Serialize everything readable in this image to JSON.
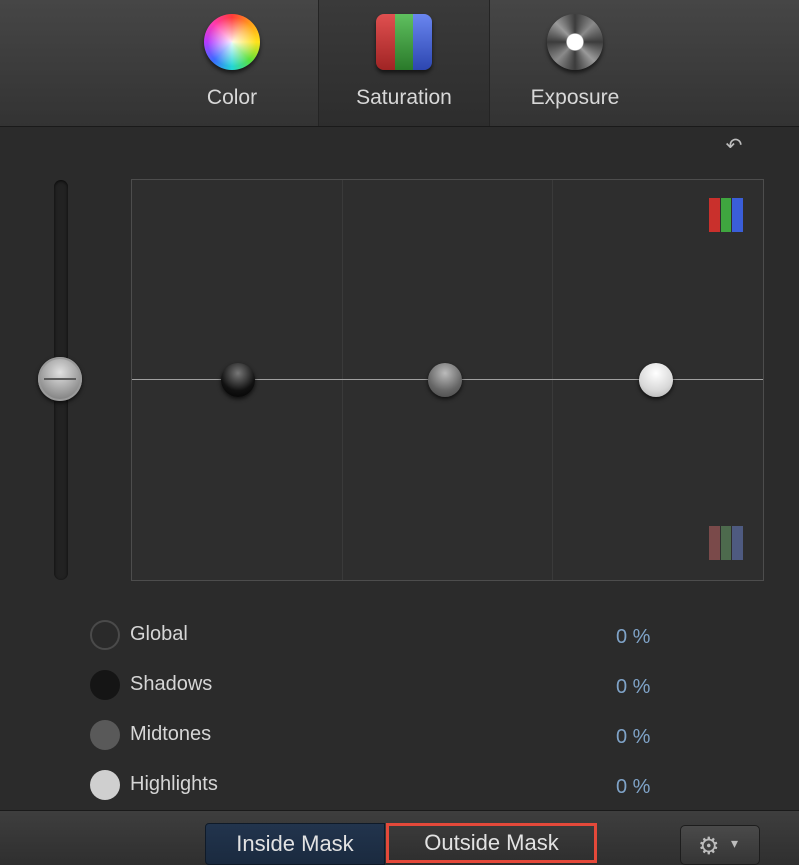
{
  "tabs": [
    {
      "label": "Color",
      "icon": "color-wheel-icon"
    },
    {
      "label": "Saturation",
      "icon": "saturation-bars-icon"
    },
    {
      "label": "Exposure",
      "icon": "exposure-wheel-icon"
    }
  ],
  "active_tab": "Saturation",
  "reset_icon": "↶",
  "parameters": [
    {
      "name": "Global",
      "value": "0 %"
    },
    {
      "name": "Shadows",
      "value": "0 %"
    },
    {
      "name": "Midtones",
      "value": "0 %"
    },
    {
      "name": "Highlights",
      "value": "0 %"
    }
  ],
  "mask": {
    "inside_label": "Inside Mask",
    "outside_label": "Outside Mask",
    "selected": "Outside Mask"
  },
  "gear": {
    "icon": "⚙",
    "caret": "▾"
  },
  "colors": {
    "highlight_border": "#e4493a",
    "value_text": "#7fa3c8",
    "rgb_top": [
      "#c9302c",
      "#3fa63f",
      "#3a5ed8"
    ],
    "rgb_bottom": [
      "#7a4a4a",
      "#4d6a4d",
      "#4e5a80"
    ]
  }
}
